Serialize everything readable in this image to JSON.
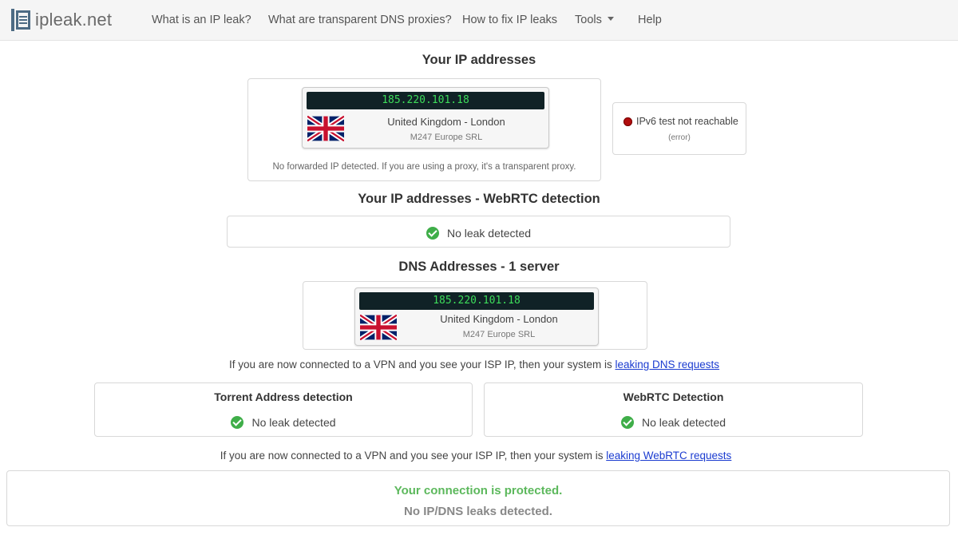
{
  "brand": {
    "name": "ipleak.net",
    "logo_icon": "ipleak-logo-icon"
  },
  "nav": {
    "items": [
      {
        "label": "What is an IP leak?"
      },
      {
        "label": "What are transparent DNS proxies?"
      },
      {
        "label": "How to fix IP leaks"
      },
      {
        "label": "Tools"
      },
      {
        "label": "Help"
      }
    ]
  },
  "ip_section": {
    "title": "Your IP addresses",
    "card": {
      "ip": "185.220.101.18",
      "flag_icon": "uk-flag-icon",
      "location": "United Kingdom - London",
      "isp": "M247 Europe SRL"
    },
    "forward_note": "No forwarded IP detected. If you are using a proxy, it's a transparent proxy.",
    "ipv6": {
      "text": "IPv6 test not reachable",
      "sub": "(error)",
      "status_color": "#b10d0d"
    }
  },
  "webrtc_section": {
    "title": "Your IP addresses - WebRTC detection",
    "status": "No leak detected"
  },
  "dns_section": {
    "title": "DNS Addresses - 1 server",
    "card": {
      "ip": "185.220.101.18",
      "flag_icon": "uk-flag-icon",
      "location": "United Kingdom - London",
      "isp": "M247 Europe SRL"
    },
    "note_prefix": "If you are now connected to a VPN and you see your ISP IP, then your system is",
    "note_link": "leaking DNS requests"
  },
  "torrent": {
    "title": "Torrent Address detection",
    "status": "No leak detected"
  },
  "webrtc_detect": {
    "title": "WebRTC Detection",
    "status": "No leak detected"
  },
  "webrtc_note": {
    "prefix": "If you are now connected to a VPN and you see your ISP IP, then your system is",
    "link": "leaking WebRTC requests"
  },
  "summary": {
    "headline": "Your connection is protected.",
    "sub": "No IP/DNS leaks detected.",
    "headline_color": "#5cb85c"
  },
  "colors": {
    "ip_bar_bg": "#102226",
    "ip_text": "#3ddc5a",
    "link": "#1a3bd0",
    "ok": "#3fae49"
  }
}
